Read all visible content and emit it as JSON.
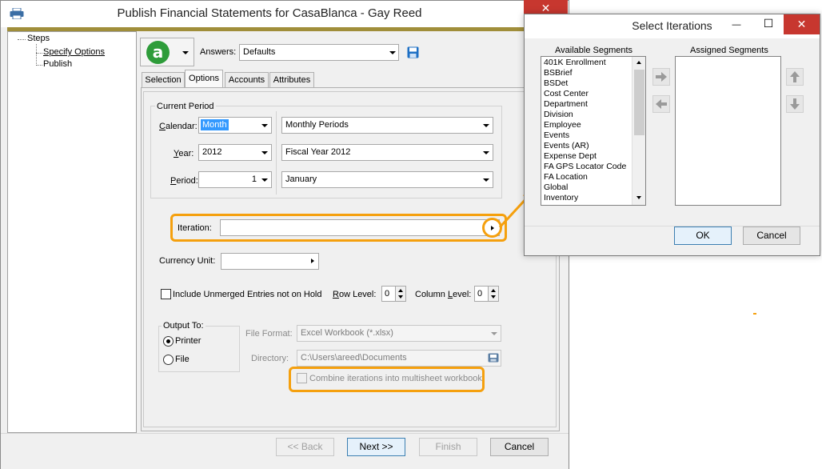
{
  "main_window": {
    "title": "Publish Financial Statements for CasaBlanca - Gay Reed",
    "close_glyph": "✕"
  },
  "steps": {
    "root": "Steps",
    "items": [
      "Specify Options",
      "Publish"
    ]
  },
  "toolbar": {
    "answers_label": "Answers:",
    "answers_value": "Defaults",
    "logo_letter": "a"
  },
  "tabs": [
    "Selection",
    "Options",
    "Accounts",
    "Attributes"
  ],
  "active_tab": "Options",
  "current_period": {
    "group_label": "Current Period",
    "calendar_label": "Calendar:",
    "calendar_value": "Month",
    "calendar_desc": "Monthly Periods",
    "year_label": "Year:",
    "year_value": "2012",
    "year_desc": "Fiscal Year 2012",
    "period_label": "Period:",
    "period_value": "1",
    "period_desc": "January"
  },
  "iteration": {
    "label": "Iteration:",
    "value": ""
  },
  "currency_unit": {
    "label": "Currency Unit:",
    "value": ""
  },
  "options": {
    "include_unmerged_label": "Include Unmerged Entries not on Hold",
    "include_unmerged_checked": false,
    "row_level_label": "Row Level:",
    "row_level_value": "0",
    "column_level_label": "Column Level:",
    "column_level_value": "0"
  },
  "output_to": {
    "group_label": "Output To:",
    "options": [
      "Printer",
      "File"
    ],
    "selected": "Printer",
    "file_format_label": "File Format:",
    "file_format_value": "Excel Workbook (*.xlsx)",
    "directory_label": "Directory:",
    "directory_value": "C:\\Users\\areed\\Documents",
    "combine_label": "Combine iterations into multisheet workbook",
    "combine_checked": false
  },
  "nav_buttons": {
    "back": "<< Back",
    "next": "Next >>",
    "finish": "Finish",
    "cancel": "Cancel"
  },
  "dialog": {
    "title": "Select Iterations",
    "available_label": "Available Segments",
    "assigned_label": "Assigned Segments",
    "available_items": [
      "401K Enrollment",
      "BSBrief",
      "BSDet",
      "Cost Center",
      "Department",
      "Division",
      "Employee",
      "Events",
      "Events (AR)",
      "Expense Dept",
      "FA GPS Locator Code",
      "FA Location",
      "Global",
      "Inventory"
    ],
    "assigned_items": [],
    "ok": "OK",
    "cancel": "Cancel",
    "close_glyph": "✕",
    "minimize_glyph": "—",
    "maximize_glyph": "☐"
  },
  "colors": {
    "highlight": "#f5a00e",
    "selection": "#3399ff",
    "logo_green": "#2e9c3a",
    "close_red": "#c7372f"
  }
}
